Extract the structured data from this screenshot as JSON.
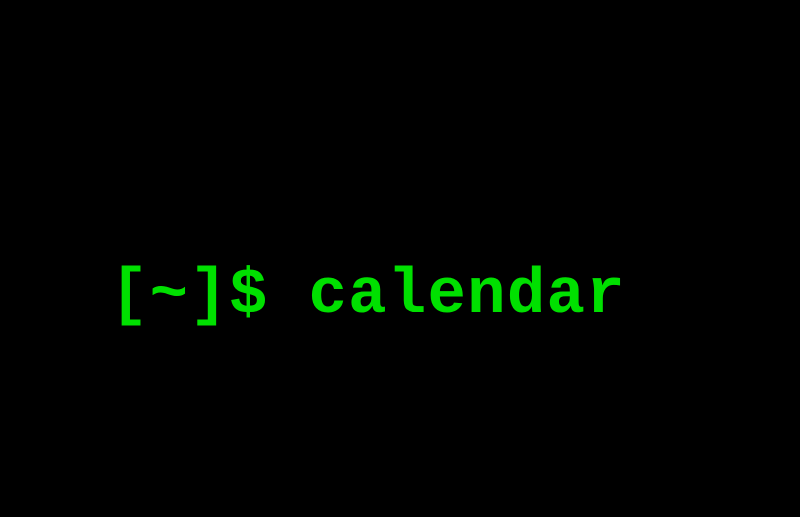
{
  "terminal": {
    "prompt": "[~]$ ",
    "command": "calendar"
  }
}
